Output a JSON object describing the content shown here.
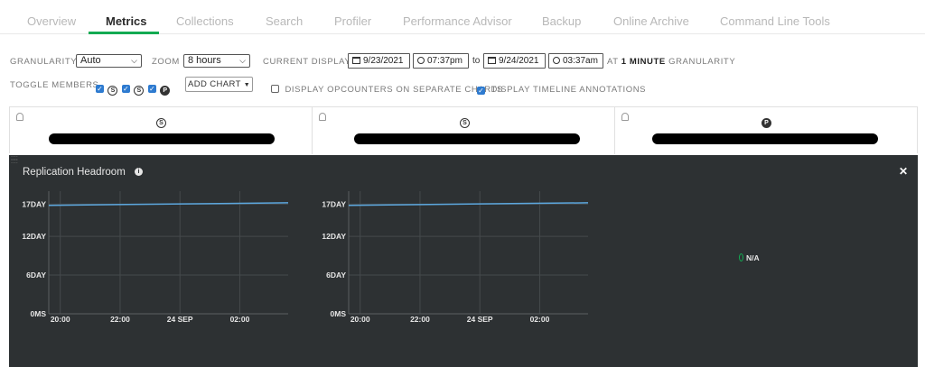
{
  "tabs": [
    "Overview",
    "Metrics",
    "Collections",
    "Search",
    "Profiler",
    "Performance Advisor",
    "Backup",
    "Online Archive",
    "Command Line Tools"
  ],
  "controls": {
    "granularity_label": "GRANULARITY",
    "granularity_value": "Auto",
    "zoom_label": "ZOOM",
    "zoom_value": "8 hours",
    "current_display_label": "CURRENT DISPLAY",
    "start_date": "9/23/2021",
    "start_time": "07:37pm",
    "to_label": "to",
    "end_date": "9/24/2021",
    "end_time": "03:37am",
    "at_label": "AT",
    "granularity_bold": "1 MINUTE",
    "granularity_suffix": "GRANULARITY",
    "toggle_members_label": "TOGGLE MEMBERS",
    "members": [
      "S",
      "S",
      "P"
    ],
    "add_chart_label": "ADD CHART",
    "opcounters_label": "DISPLAY OPCOUNTERS ON SEPARATE CHARTS",
    "opcounters_checked": false,
    "timeline_label": "DISPLAY TIMELINE ANNOTATIONS",
    "timeline_checked": true
  },
  "hosts": [
    {
      "role": "S"
    },
    {
      "role": "S"
    },
    {
      "role": "P"
    }
  ],
  "panel": {
    "title": "Replication Headroom",
    "na_label": "N/A"
  },
  "chart_data": [
    {
      "type": "line",
      "title": "",
      "y_ticks": [
        "17DAY",
        "12DAY",
        "6DAY",
        "0MS"
      ],
      "y_tick_values_days": [
        17,
        12,
        6,
        0
      ],
      "x_ticks": [
        "20:00",
        "22:00",
        "24 SEP",
        "02:00"
      ],
      "xlim": [
        "9/23/2021 19:37",
        "9/24/2021 03:37"
      ],
      "series": [
        {
          "x": [
            "9/23/2021 19:37",
            "9/24/2021 03:37"
          ],
          "values_days": [
            16.8,
            17.2
          ]
        }
      ],
      "color": "#5ca7de"
    },
    {
      "type": "line",
      "title": "",
      "y_ticks": [
        "17DAY",
        "12DAY",
        "6DAY",
        "0MS"
      ],
      "y_tick_values_days": [
        17,
        12,
        6,
        0
      ],
      "x_ticks": [
        "20:00",
        "22:00",
        "24 SEP",
        "02:00"
      ],
      "xlim": [
        "9/23/2021 19:37",
        "9/24/2021 03:37"
      ],
      "series": [
        {
          "x": [
            "9/23/2021 19:37",
            "9/24/2021 03:37"
          ],
          "values_days": [
            16.8,
            17.2
          ]
        }
      ],
      "color": "#5ca7de"
    }
  ]
}
